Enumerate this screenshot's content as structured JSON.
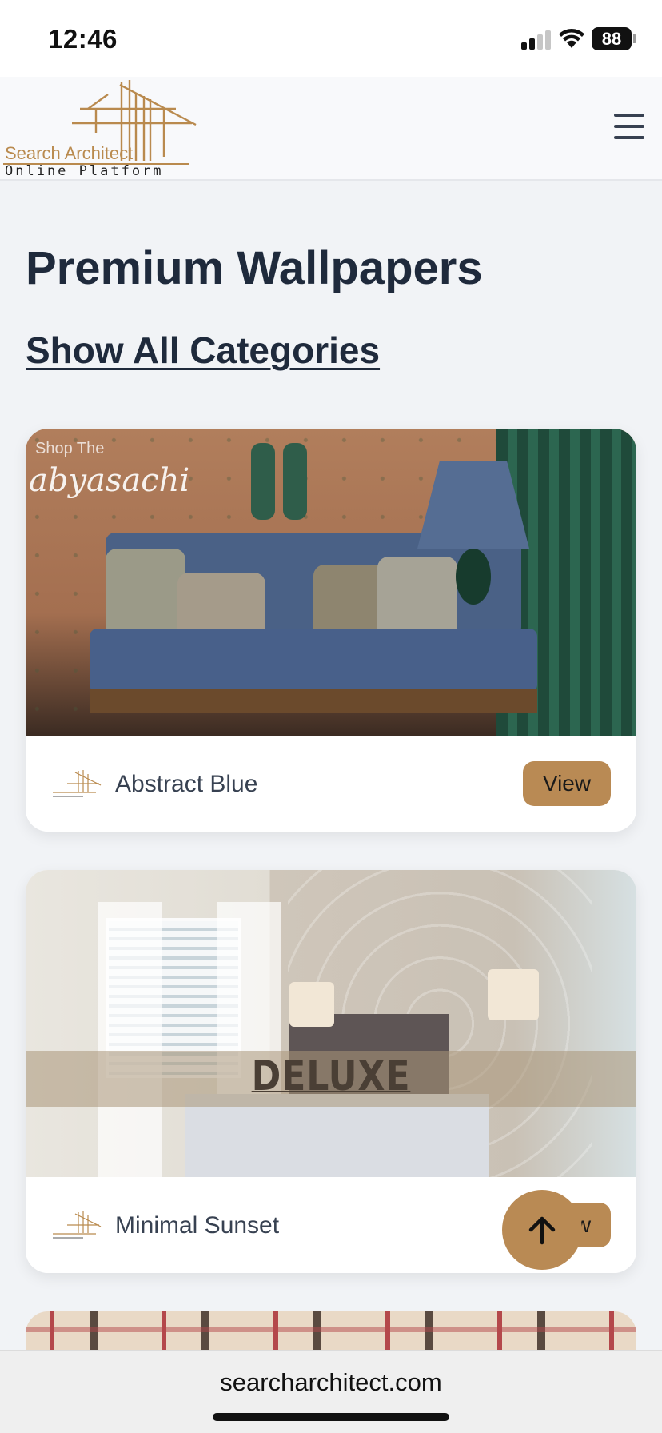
{
  "status_bar": {
    "time": "12:46",
    "battery": "88"
  },
  "header": {
    "logo_line1": "Search Architect",
    "logo_line2": "Online Platform"
  },
  "page": {
    "title": "Premium Wallpapers",
    "categories_link": "Show All Categories"
  },
  "cards": [
    {
      "name": "Abstract Blue",
      "button_label": "View",
      "image_overlay_small": "Shop The",
      "image_overlay_brand": "abyasachi"
    },
    {
      "name": "Minimal Sunset",
      "button_label": "View",
      "image_overlay_banner": "DELUXE"
    }
  ],
  "browser": {
    "url": "searcharchitect.com"
  },
  "colors": {
    "accent": "#b98a54",
    "heading": "#1f2a3c",
    "background": "#f1f3f6"
  },
  "icons": {
    "menu": "hamburger-icon",
    "scroll_top": "arrow-up-icon",
    "signal": "cellular-signal-icon",
    "wifi": "wifi-icon",
    "battery": "battery-icon"
  }
}
